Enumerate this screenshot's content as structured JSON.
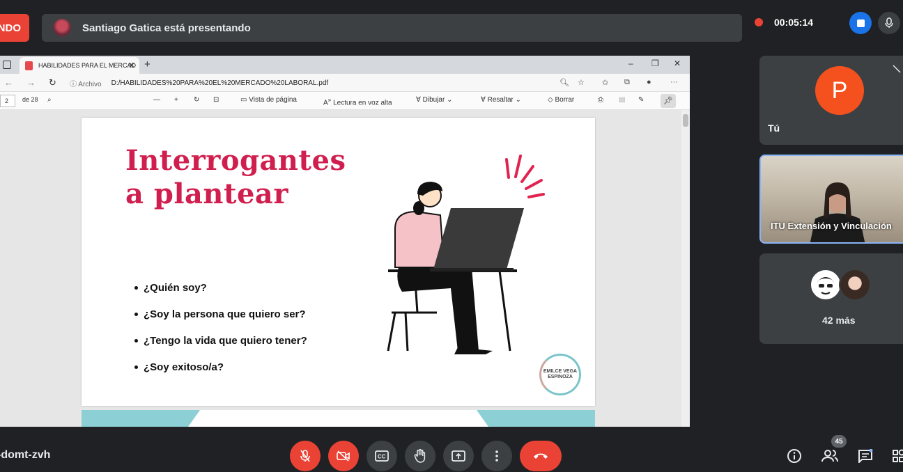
{
  "top": {
    "presenting_label": "NDO",
    "presenter_text": "Santiago Gatica está presentando",
    "timer": "00:05:14"
  },
  "browser": {
    "tab_title": "HABILIDADES PARA EL MERCAD",
    "url_info": "Archivo",
    "url": "D:/HABILIDADES%20PARA%20EL%20MERCADO%20LABORAL.pdf",
    "page_current": "2",
    "page_total": "de 28",
    "toolbar": {
      "page_view": "Vista de página",
      "read_aloud": "Lectura en voz alta",
      "draw": "Dibujar",
      "highlight": "Resaltar",
      "erase": "Borrar"
    }
  },
  "slide": {
    "title_line1": "Interrogantes",
    "title_line2": "a plantear",
    "bullets": [
      "¿Quién soy?",
      "¿Soy la persona que quiero ser?",
      "¿Tengo la vida que quiero tener?",
      "¿Soy exitoso/a?"
    ],
    "logo_text": "EMILCE VEGA ESPINOZA"
  },
  "tiles": {
    "self_initial": "P",
    "self_name": "Tú",
    "video_name": "ITU Extensión y Vinculación",
    "more_label": "42 más"
  },
  "bottom": {
    "meeting_code": "-domt-zvh",
    "participants_count": "45"
  },
  "colors": {
    "accent_red": "#ea4335",
    "accent_blue": "#1a73e8",
    "slide_title": "#d01f4f",
    "avatar": "#f4511e"
  }
}
